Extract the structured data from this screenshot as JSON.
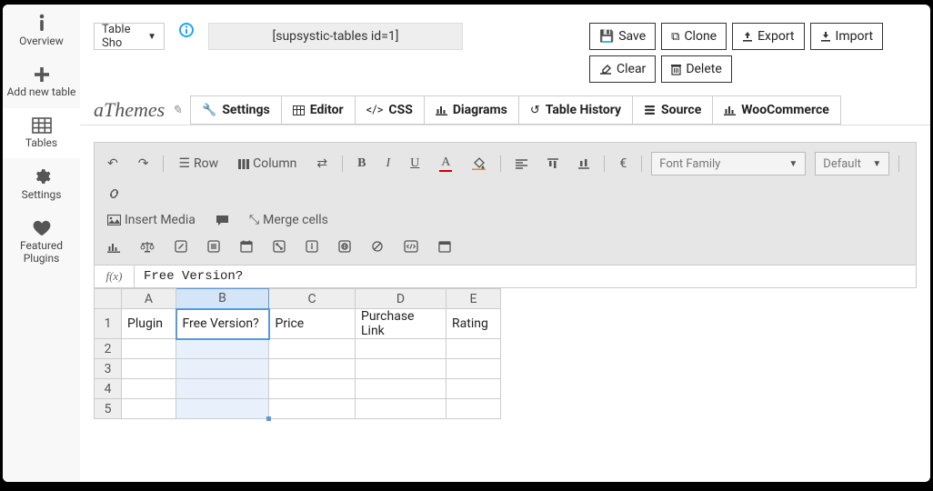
{
  "leftnav": [
    {
      "icon": "info",
      "label": "Overview"
    },
    {
      "icon": "plus",
      "label": "Add new table"
    },
    {
      "icon": "grid",
      "label": "Tables"
    },
    {
      "icon": "gear",
      "label": "Settings"
    },
    {
      "icon": "heart",
      "label": "Featured Plugins"
    }
  ],
  "toprow": {
    "dropdown": "Table Sho",
    "shortcode": "[supsystic-tables id=1]"
  },
  "buttons": {
    "save": "Save",
    "clone": "Clone",
    "export": "Export",
    "import": "Import",
    "clear": "Clear",
    "delete": "Delete"
  },
  "title": "aThemes",
  "tabs": {
    "settings": "Settings",
    "editor": "Editor",
    "css": "CSS",
    "diagrams": "Diagrams",
    "history": "Table History",
    "source": "Source",
    "woo": "WooCommerce"
  },
  "toolbar": {
    "row": "Row",
    "column": "Column",
    "insertMedia": "Insert Media",
    "mergeCells": "Merge cells",
    "fontFamily": "Font Family",
    "fontSize": "Default"
  },
  "formula": {
    "fx": "f(x)",
    "value": "Free Version?"
  },
  "columns": [
    "A",
    "B",
    "C",
    "D",
    "E"
  ],
  "rows": [
    "1",
    "2",
    "3",
    "4",
    "5"
  ],
  "cells": {
    "r1": {
      "A": "Plugin",
      "B": "Free Version?",
      "C": "Price",
      "D": "Purchase Link",
      "E": "Rating"
    }
  },
  "selected": {
    "col": "B",
    "row": 1
  }
}
